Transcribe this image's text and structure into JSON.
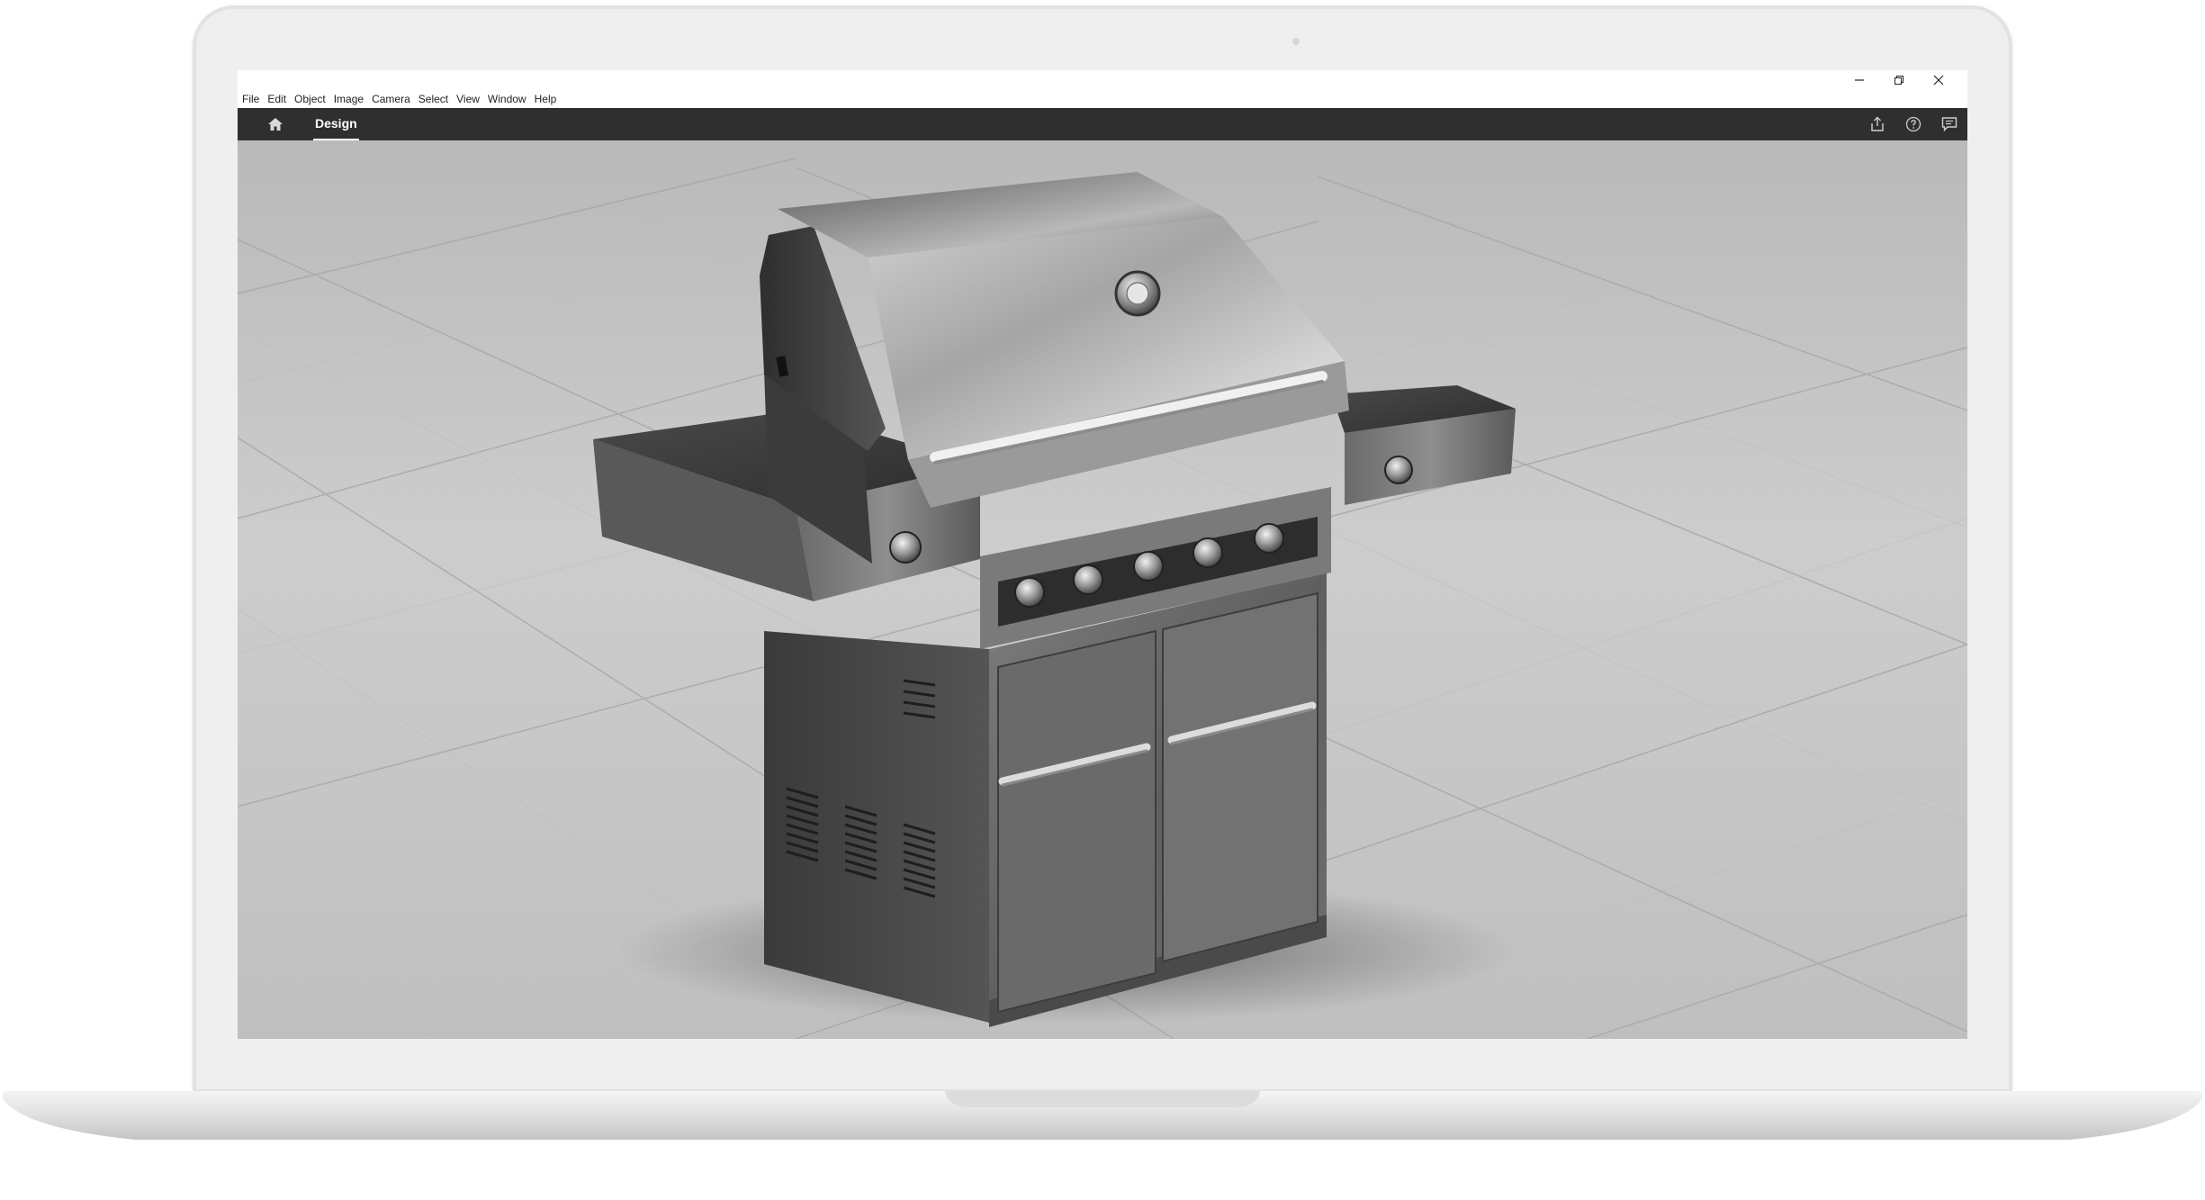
{
  "window": {
    "controls": [
      "minimize",
      "restore",
      "close"
    ]
  },
  "menu": {
    "items": [
      {
        "label": "File"
      },
      {
        "label": "Edit"
      },
      {
        "label": "Object"
      },
      {
        "label": "Image"
      },
      {
        "label": "Camera"
      },
      {
        "label": "Select"
      },
      {
        "label": "View"
      },
      {
        "label": "Window"
      },
      {
        "label": "Help"
      }
    ]
  },
  "toolbar": {
    "home_icon": "home-icon",
    "active_tab": "Design",
    "right_icons": [
      "share-icon",
      "help-icon",
      "feedback-icon"
    ],
    "background": "#2f2f2f"
  },
  "viewport": {
    "scene": "stainless steel gas grill on tiled floor grid",
    "background": "#c8c8c8"
  }
}
